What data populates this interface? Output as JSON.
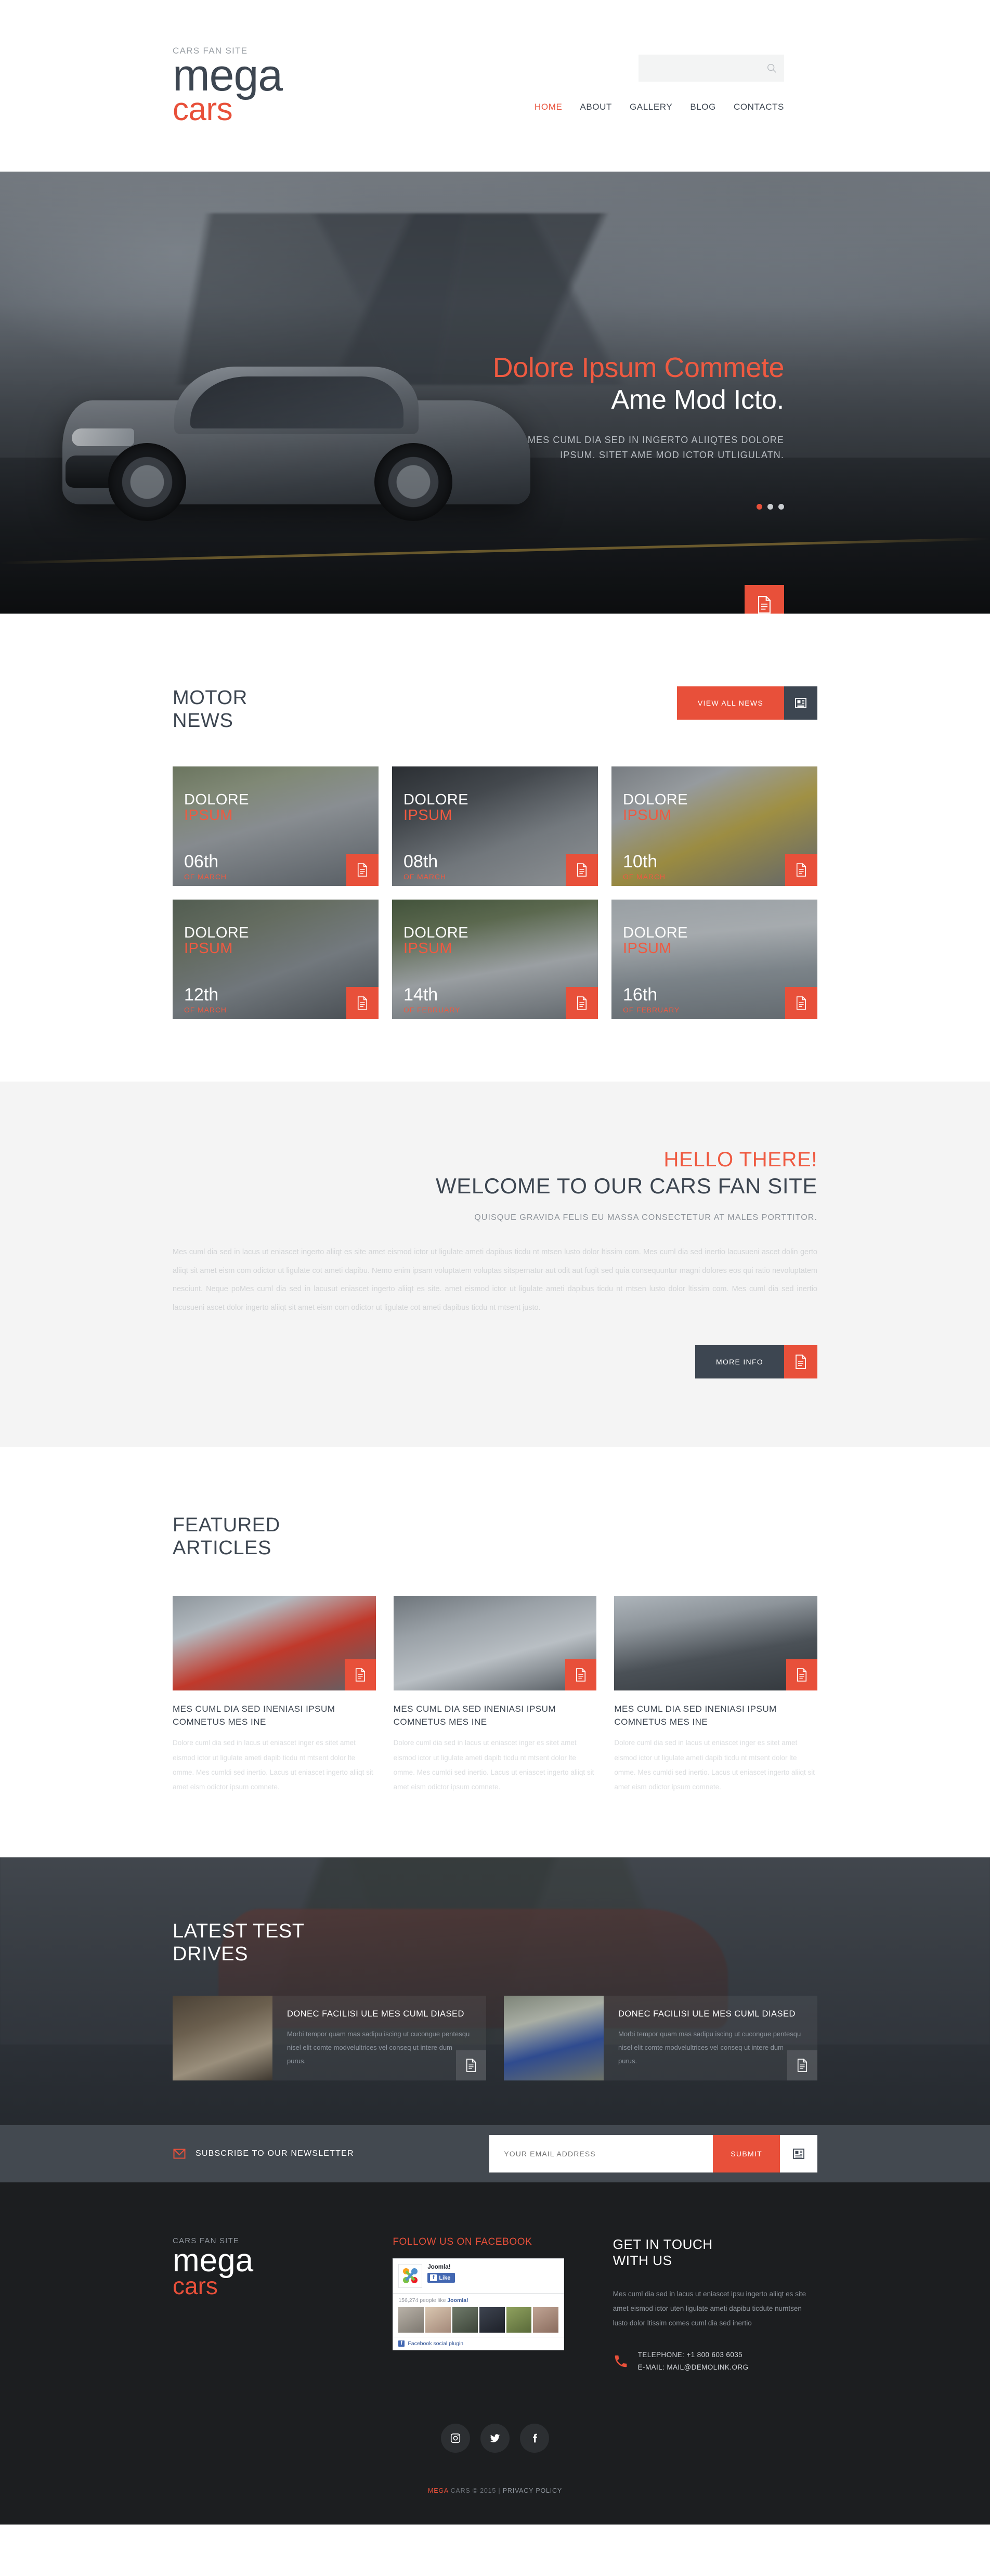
{
  "header": {
    "logo_tagline": "CARS FAN SITE",
    "logo_main": "mega",
    "logo_accent": "cars",
    "search_placeholder": "",
    "search_value": "",
    "search_icon": "search-icon",
    "nav": [
      {
        "label": "HOME",
        "active": true
      },
      {
        "label": "ABOUT",
        "active": false
      },
      {
        "label": "GALLERY",
        "active": false
      },
      {
        "label": "BLOG",
        "active": false
      },
      {
        "label": "CONTACTS",
        "active": false
      }
    ]
  },
  "hero": {
    "title_accent": "Dolore Ipsum Commete",
    "title_main": "Ame Mod Icto.",
    "description": "MES CUML DIA SED IN INGERTO ALIIQTES DOLORE IPSUM. SITET AME MOD ICTOR UTLIGULATN.",
    "button_icon": "document-icon",
    "slide_count": 3,
    "active_slide": 1
  },
  "news": {
    "title_line1": "MOTOR",
    "title_line2": "NEWS",
    "view_all_label": "VIEW ALL NEWS",
    "view_all_icon": "newspaper-icon",
    "cards": [
      {
        "title_line1": "DOLORE",
        "title_line2": "IPSUM",
        "day": "06th",
        "month": "OF MARCH",
        "icon": "document-icon"
      },
      {
        "title_line1": "DOLORE",
        "title_line2": "IPSUM",
        "day": "08th",
        "month": "OF MARCH",
        "icon": "document-icon"
      },
      {
        "title_line1": "DOLORE",
        "title_line2": "IPSUM",
        "day": "10th",
        "month": "OF MARCH",
        "icon": "document-icon"
      },
      {
        "title_line1": "DOLORE",
        "title_line2": "IPSUM",
        "day": "12th",
        "month": "OF MARCH",
        "icon": "document-icon"
      },
      {
        "title_line1": "DOLORE",
        "title_line2": "IPSUM",
        "day": "14th",
        "month": "OF FEBRUARY",
        "icon": "document-icon"
      },
      {
        "title_line1": "DOLORE",
        "title_line2": "IPSUM",
        "day": "16th",
        "month": "OF FEBRUARY",
        "icon": "document-icon"
      }
    ]
  },
  "welcome": {
    "hello": "HELLO THERE!",
    "title": "WELCOME TO OUR CARS FAN SITE",
    "subtitle": "QUISQUE GRAVIDA FELIS EU MASSA CONSECTETUR AT MALES PORTTITOR.",
    "body": "Mes cuml dia sed in lacus ut eniascet ingerto aliiqt es site amet eismod ictor ut ligulate ameti dapibus ticdu nt mtsen lusto dolor ltissim com. Mes cuml dia sed inertio lacusueni ascet dolin gerto aliiqt sit amet eism com odictor ut ligulate cot ameti dapibu. Nemo enim ipsam voluptatem voluptas sitspernatur aut odit aut fugit sed quia consequuntur magni dolores eos qui ratio nevoluptatem nesciunt. Neque poMes cuml dia sed in lacusut eniascet ingerto aliiqt es site. amet eismod ictor ut ligulate ameti dapibus ticdu nt mtsen lusto dolor ltissim com. Mes cuml dia sed inertio lacusueni ascet dolor ingerto aliiqt sit amet eism com odictor ut ligulate cot ameti dapibus ticdu nt mtsent justo.",
    "more_info_label": "MORE INFO",
    "more_info_icon": "document-icon"
  },
  "featured": {
    "title_line1": "FEATURED",
    "title_line2": "ARTICLES",
    "cards": [
      {
        "title": "MES CUML DIA SED INENIASI IPSUM COMNETUS MES INE",
        "text": "Dolore cuml dia sed in lacus ut eniascet inger es sitet amet eismod ictor ut ligulate ameti dapib ticdu nt mtsent dolor lte omme. Mes cumldi sed inertio. Lacus ut eniascet ingerto aliiqt sit amet eism odictor ipsum comnete.",
        "icon": "document-icon"
      },
      {
        "title": "MES CUML DIA SED INENIASI IPSUM COMNETUS MES INE",
        "text": "Dolore cuml dia sed in lacus ut eniascet inger es sitet amet eismod ictor ut ligulate ameti dapib ticdu nt mtsent dolor lte omme. Mes cumldi sed inertio. Lacus ut eniascet ingerto aliiqt sit amet eism odictor ipsum comnete.",
        "icon": "document-icon"
      },
      {
        "title": "MES CUML DIA SED INENIASI IPSUM COMNETUS MES INE",
        "text": "Dolore cuml dia sed in lacus ut eniascet inger es sitet amet eismod ictor ut ligulate ameti dapib ticdu nt mtsent dolor lte omme. Mes cumldi sed inertio. Lacus ut eniascet ingerto aliiqt sit amet eism odictor ipsum comnete.",
        "icon": "document-icon"
      }
    ]
  },
  "drives": {
    "title_line1": "LATEST TEST",
    "title_line2": "DRIVES",
    "cards": [
      {
        "title": "DONEC FACILISI ULE MES CUML DIASED",
        "text": "Morbi tempor quam mas sadipu iscing ut cucongue pentesqu nisel elit comte modvelultrices vel conseq ut intere dum purus.",
        "icon": "document-icon"
      },
      {
        "title": "DONEC FACILISI ULE MES CUML DIASED",
        "text": "Morbi tempor quam mas sadipu iscing ut cucongue pentesqu nisel elit comte modvelultrices vel conseq ut intere dum purus.",
        "icon": "document-icon"
      }
    ]
  },
  "subscribe": {
    "icon": "envelope-icon",
    "label": "SUBSCRIBE TO OUR NEWSLETTER",
    "email_placeholder": "YOUR EMAIL ADDRESS",
    "email_value": "",
    "submit_label": "SUBMIT",
    "submit_icon": "newspaper-icon"
  },
  "footer": {
    "logo_tagline": "CARS FAN SITE",
    "logo_main": "mega",
    "logo_accent": "cars",
    "facebook": {
      "heading": "FOLLOW US ON FACEBOOK",
      "page_name": "Joomla!",
      "like_label": "Like",
      "like_icon": "facebook-icon",
      "count_text": "156,274 people like",
      "count_link": "Joomla!",
      "footer_label": "Facebook social plugin",
      "footer_icon": "facebook-icon"
    },
    "contact": {
      "heading_line1": "GET IN TOUCH",
      "heading_line2": "WITH US",
      "text": "Mes cuml dia sed in lacus ut eniascet ipsu ingerto aliiqt es site amet eismod ictor uten ligulate ameti dapibu ticdute numtsen lusto dolor ltissim comes cuml dia sed inertio",
      "phone_icon": "phone-icon",
      "telephone": "TELEPHONE: +1 800 603 6035",
      "email": "E-MAIL: MAIL@DEMOLINK.ORG"
    },
    "socials": [
      {
        "name": "instagram-icon"
      },
      {
        "name": "twitter-icon"
      },
      {
        "name": "facebook-icon"
      }
    ],
    "copyright_brand": "MEGA",
    "copyright_brand2": "CARS",
    "copyright_rest": "© 2015 |",
    "privacy_label": "Privacy Policy"
  }
}
